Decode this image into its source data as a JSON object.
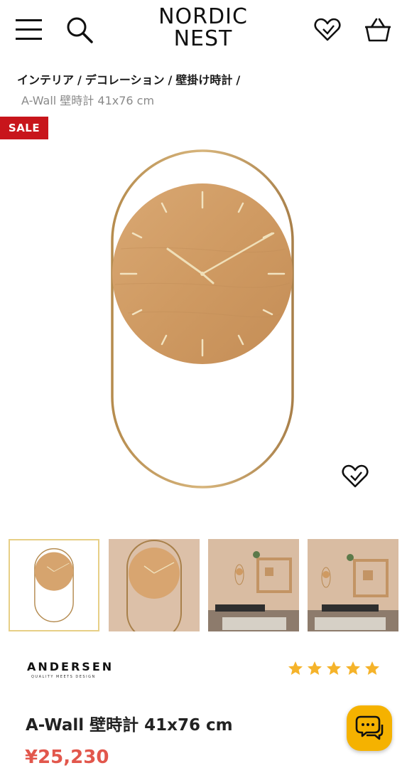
{
  "header": {
    "logo_line1": "NORDIC",
    "logo_line2": "NEST",
    "icons": [
      "menu-icon",
      "search-icon",
      "heart-icon",
      "basket-icon"
    ]
  },
  "breadcrumb": {
    "items": [
      "インテリア",
      "デコレーション",
      "壁掛け時計"
    ],
    "separator": "/",
    "current": "A-Wall 壁時計 41x76 cm"
  },
  "badge": {
    "label": "SALE",
    "color": "#c8151b"
  },
  "gallery": {
    "thumbnail_count": 4,
    "active_index": 0
  },
  "brand": {
    "name": "ANDERSEN",
    "tagline": "QUALITY MEETS DESIGN"
  },
  "rating": {
    "stars": 5,
    "max": 5,
    "color": "#f5b32a"
  },
  "product": {
    "title": "A-Wall 壁時計 41x76 cm",
    "price": "¥25,230",
    "price_color": "#e2574c"
  },
  "chat": {
    "icon": "chat-icon",
    "color": "#f5b200"
  }
}
